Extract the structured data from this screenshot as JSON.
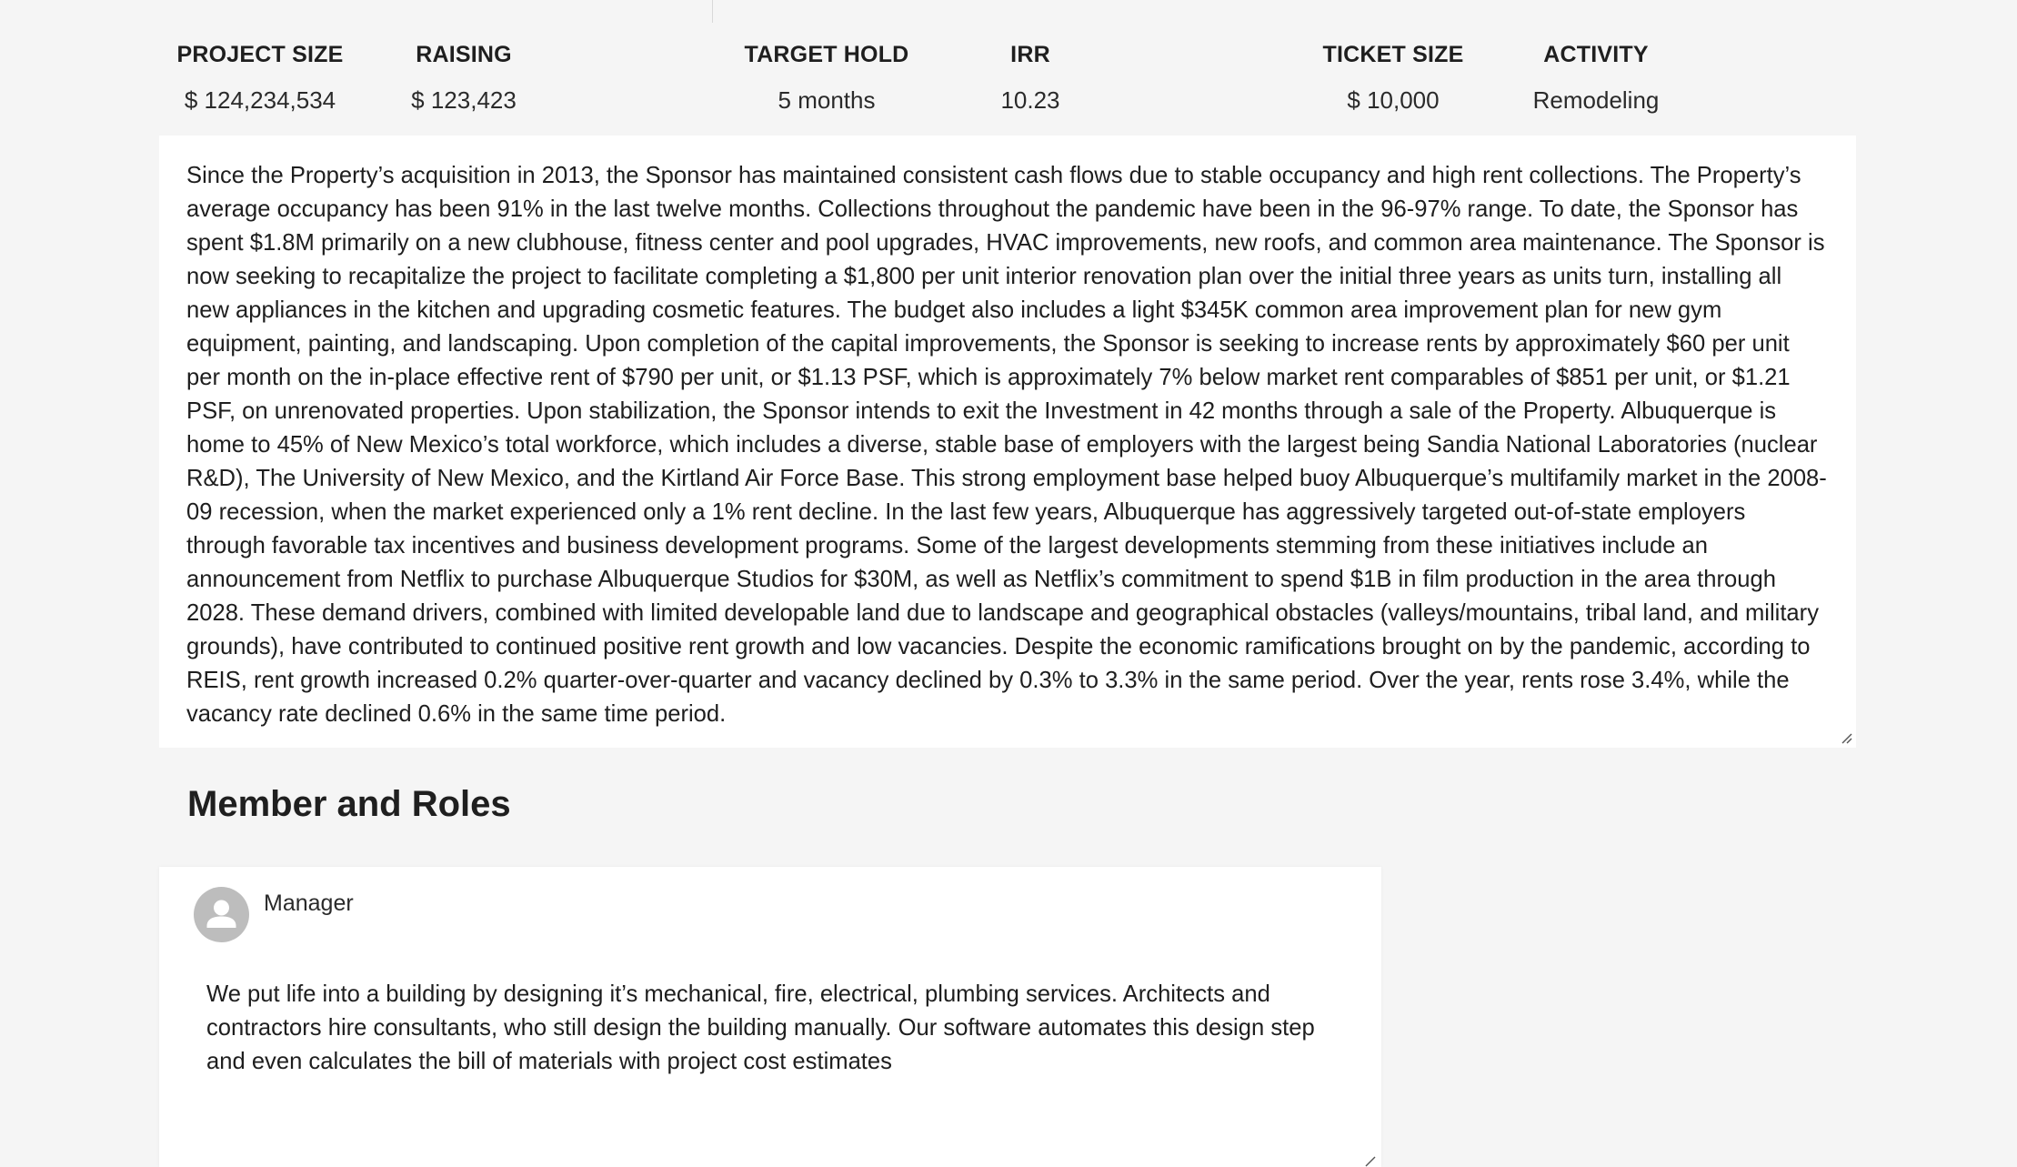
{
  "stats": [
    {
      "label": "PROJECT SIZE",
      "value": "$ 124,234,534"
    },
    {
      "label": "RAISING",
      "value": "$ 123,423"
    },
    {
      "label": "TARGET HOLD",
      "value": "5 months"
    },
    {
      "label": "IRR",
      "value": "10.23"
    },
    {
      "label": "TICKET SIZE",
      "value": "$ 10,000"
    },
    {
      "label": "ACTIVITY",
      "value": "Remodeling"
    }
  ],
  "description": {
    "text": "Since the Property’s acquisition in 2013, the Sponsor has maintained consistent cash flows due to stable occupancy and high rent collections. The Property’s average occupancy has been 91% in the last twelve months. Collections throughout the pandemic have been in the 96-97% range. To date, the Sponsor has spent $1.8M primarily on a new clubhouse, fitness center and pool upgrades, HVAC improvements, new roofs, and common area maintenance. The Sponsor is now seeking to recapitalize the project to facilitate completing a $1,800 per unit interior renovation plan over the initial three years as units turn, installing all new appliances in the kitchen and upgrading cosmetic features. The budget also includes a light $345K common area improvement plan for new gym equipment, painting, and landscaping. Upon completion of the capital improvements, the Sponsor is seeking to increase rents by approximately $60 per unit per month on the in-place effective rent of $790 per unit, or $1.13 PSF, which is approximately 7% below market rent comparables of $851 per unit, or $1.21 PSF, on unrenovated properties. Upon stabilization, the Sponsor intends to exit the Investment in 42 months through a sale of the Property. Albuquerque is home to 45% of New Mexico’s total workforce, which includes a diverse, stable base of employers with the largest being Sandia National Laboratories (nuclear R&D), The University of New Mexico, and the Kirtland Air Force Base. This strong employment base helped buoy Albuquerque’s multifamily market in the 2008-09 recession, when the market experienced only a 1% rent decline. In the last few years, Albuquerque has aggressively targeted out-of-state employers through favorable tax incentives and business development programs. Some of the largest developments stemming from these initiatives include an announcement from Netflix to purchase Albuquerque Studios for $30M, as well as Netflix’s commitment to spend $1B in film production in the area through 2028. These demand drivers, combined with limited developable land due to landscape and geographical obstacles (valleys/mountains, tribal land, and military grounds), have contributed to continued positive rent growth and low vacancies. Despite the economic ramifications brought on by the pandemic, according to REIS, rent growth increased 0.2% quarter-over-quarter and vacancy declined by 0.3% to 3.3% in the same period. Over the year, rents rose 3.4%, while the vacancy rate declined 0.6% in the same time period."
  },
  "members_section": {
    "title": "Member and Roles",
    "members": [
      {
        "role": "Manager",
        "avatar_icon": "user-icon",
        "bio": "We put life into a building by designing it’s mechanical, fire, electrical, plumbing services. Architects and contractors hire consultants, who still design the building manually. Our software automates this design step and even calculates the bill of materials with project cost estimates"
      }
    ]
  },
  "colors": {
    "page_background": "#f5f5f5",
    "card_background": "#ffffff",
    "avatar_background": "#bdbdbd",
    "text": "#222222"
  }
}
